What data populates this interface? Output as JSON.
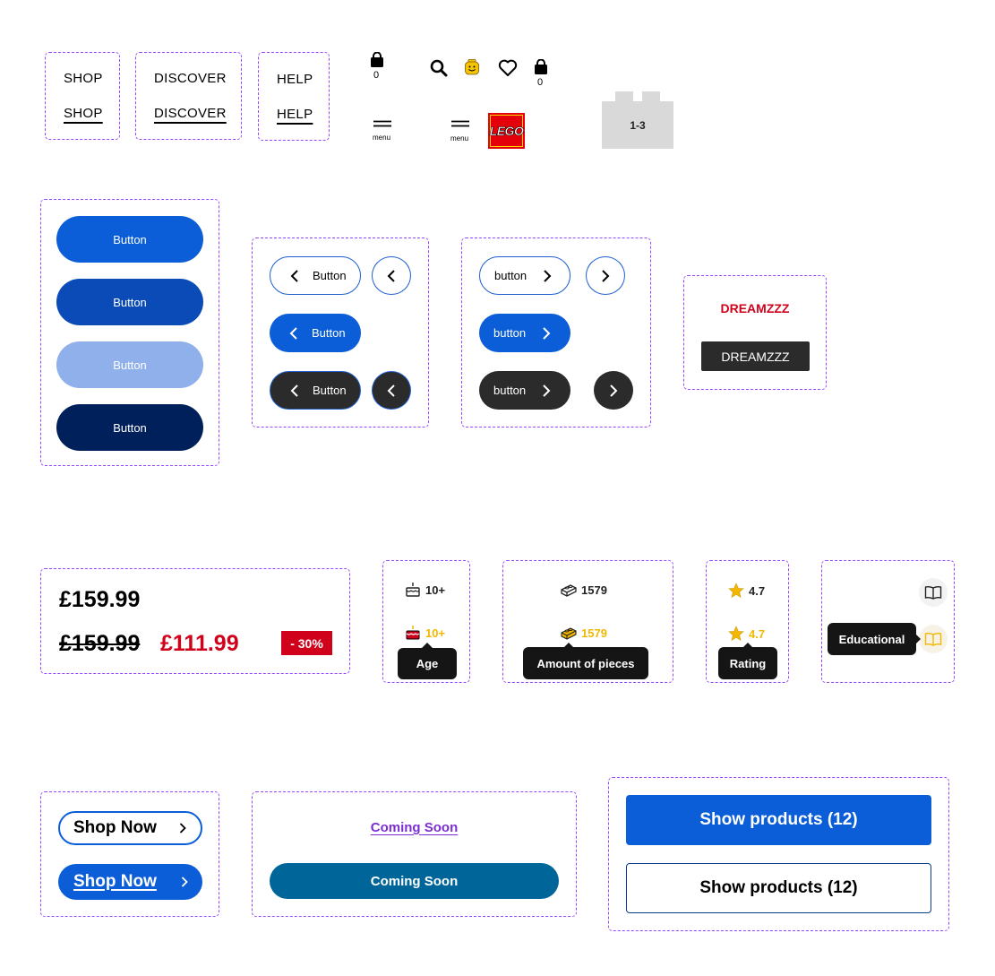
{
  "colors": {
    "accent_blue": "#0b5ed7",
    "dark_blue": "#00205b",
    "disabled_blue": "#8fb0ea",
    "dark_gray": "#2b2b2b",
    "sale_red": "#d0021b",
    "gold": "#f2b800",
    "purple_link": "#7b2fd1",
    "teal_button": "#006699",
    "dashed_frame": "#9747ff"
  },
  "nav": {
    "shop": "SHOP",
    "shop_underlined": "SHOP",
    "discover": "DISCOVER",
    "discover_underlined": "DISCOVER",
    "help": "HELP",
    "help_underlined": "HELP"
  },
  "header_icons": {
    "bag_count_1": "0",
    "bag_count_2": "0",
    "menu_label_1": "menu",
    "menu_label_2": "menu",
    "logo_text": "LEGO",
    "brick_label": "1-3",
    "icons": [
      "shopping-bag-icon",
      "search-icon",
      "minifig-head-icon",
      "heart-icon",
      "shopping-bag-icon",
      "hamburger-menu-icon",
      "lego-logo",
      "brick-icon"
    ]
  },
  "buttons": {
    "primary": "Button",
    "primary_hover": "Button",
    "primary_disabled": "Button",
    "primary_pressed": "Button",
    "back_outline": "Button",
    "back_blue": "Button",
    "back_dark": "Button",
    "next_outline": "button",
    "next_blue": "button",
    "next_dark": "button"
  },
  "theme_tags": {
    "text": "DREAMZZZ",
    "filled": "DREAMZZZ"
  },
  "price": {
    "regular": "£159.99",
    "was": "£159.99",
    "now": "£111.99",
    "discount_badge": "- 30%"
  },
  "attributes": {
    "age": "10+",
    "age_active": "10+",
    "age_tooltip": "Age",
    "pieces": "1579",
    "pieces_active": "1579",
    "pieces_tooltip": "Amount of pieces",
    "rating": "4.7",
    "rating_active": "4.7",
    "rating_tooltip": "Rating",
    "educational_tooltip": "Educational"
  },
  "cta": {
    "shop_now": "Shop Now",
    "shop_now_blue": "Shop Now",
    "coming_soon_link": "Coming Soon",
    "coming_soon_button": "Coming Soon",
    "show_products_filled": "Show products (12)",
    "show_products_outline": "Show products (12)"
  }
}
